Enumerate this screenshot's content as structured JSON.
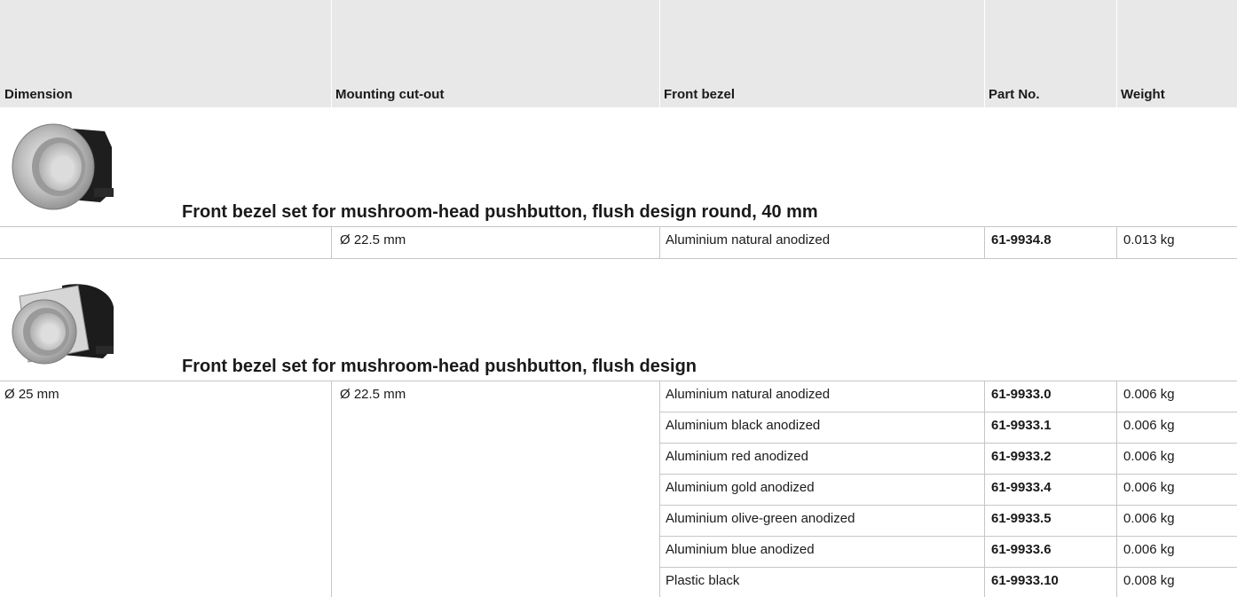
{
  "headers": {
    "dimension": "Dimension",
    "mounting": "Mounting cut-out",
    "bezel": "Front bezel",
    "part": "Part No.",
    "weight": "Weight"
  },
  "sections": [
    {
      "title": "Front bezel set for mushroom-head pushbutton, flush design round, 40 mm",
      "rows": [
        {
          "dimension": "",
          "mounting": "Ø 22.5 mm",
          "bezel": "Aluminium natural anodized",
          "part": "61-9934.8",
          "weight": "0.013 kg"
        }
      ]
    },
    {
      "title": "Front bezel set for mushroom-head pushbutton, flush design",
      "dimension": "Ø 25 mm",
      "mounting": "Ø 22.5 mm",
      "rows": [
        {
          "bezel": "Aluminium natural anodized",
          "part": "61-9933.0",
          "weight": "0.006 kg"
        },
        {
          "bezel": "Aluminium black anodized",
          "part": "61-9933.1",
          "weight": "0.006 kg"
        },
        {
          "bezel": "Aluminium red anodized",
          "part": "61-9933.2",
          "weight": "0.006 kg"
        },
        {
          "bezel": "Aluminium gold anodized",
          "part": "61-9933.4",
          "weight": "0.006 kg"
        },
        {
          "bezel": "Aluminium olive-green anodized",
          "part": "61-9933.5",
          "weight": "0.006 kg"
        },
        {
          "bezel": "Aluminium blue anodized",
          "part": "61-9933.6",
          "weight": "0.006 kg"
        },
        {
          "bezel": "Plastic black",
          "part": "61-9933.10",
          "weight": "0.008 kg"
        }
      ]
    }
  ]
}
